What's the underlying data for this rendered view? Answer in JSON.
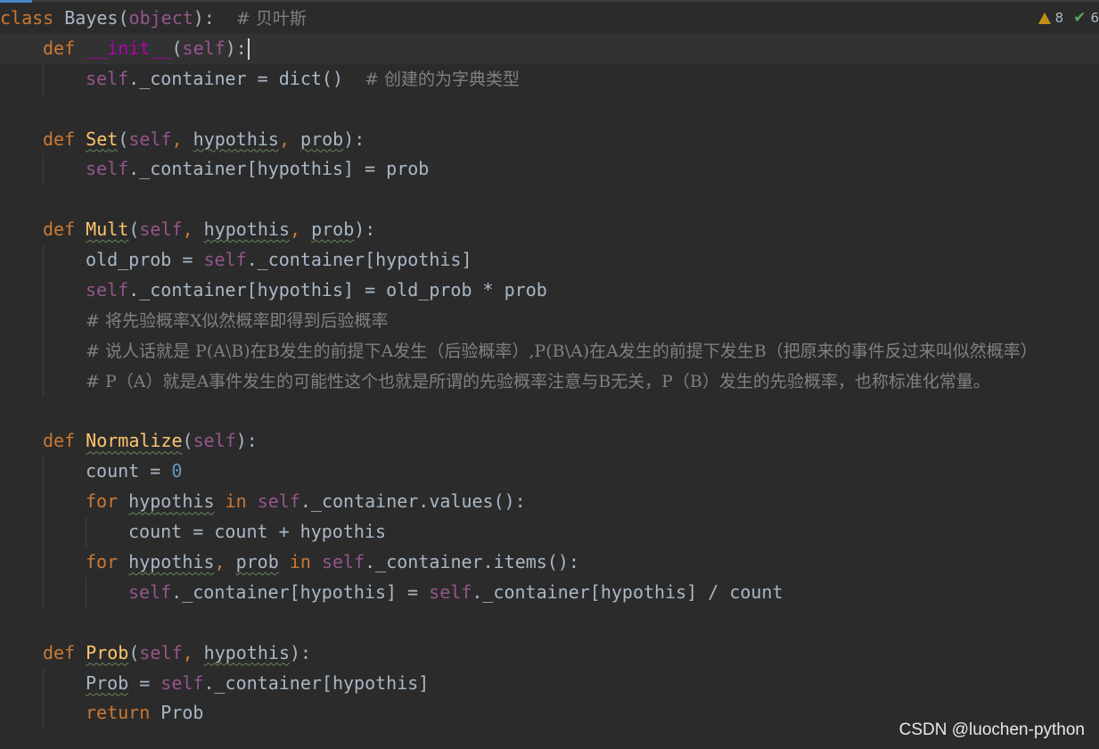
{
  "editor": {
    "inspection": {
      "warnings": "8",
      "weak_warnings": "6"
    },
    "code": {
      "l1": {
        "kw": "class",
        "name": "Bayes",
        "open": "(",
        "base": "object",
        "close": "):",
        "comment": "# 贝叶斯"
      },
      "l2": {
        "kw": "def",
        "name": "__init__",
        "open": "(",
        "self": "self",
        "close": "):"
      },
      "l3": {
        "self": "self",
        "attr": "._container = ",
        "call": "dict()",
        "comment": "# 创建的为字典类型"
      },
      "l5": {
        "kw": "def",
        "name": "Set",
        "open": "(",
        "self": "self",
        "comma1": ", ",
        "p1": "hypothis",
        "comma2": ", ",
        "p2": "prob",
        "close": "):"
      },
      "l6": {
        "self": "self",
        "rest": "._container[hypothis] = prob"
      },
      "l8": {
        "kw": "def",
        "name": "Mult",
        "open": "(",
        "self": "self",
        "comma1": ", ",
        "p1": "hypothis",
        "comma2": ", ",
        "p2": "prob",
        "close": "):"
      },
      "l9": {
        "lhs": "old_prob = ",
        "self": "self",
        "rest": "._container[hypothis]"
      },
      "l10": {
        "self": "self",
        "rest": "._container[hypothis] = old_prob * prob"
      },
      "l11": {
        "comment": "# 将先验概率X似然概率即得到后验概率"
      },
      "l12": {
        "comment": "# 说人话就是 P(A\\B)在B发生的前提下A发生（后验概率）,P(B\\A)在A发生的前提下发生B（把原来的事件反过来叫似然概率）"
      },
      "l13": {
        "comment": "# P（A）就是A事件发生的可能性这个也就是所谓的先验概率注意与B无关，P（B）发生的先验概率，也称标准化常量。"
      },
      "l15": {
        "kw": "def",
        "name": "Normalize",
        "open": "(",
        "self": "self",
        "close": "):"
      },
      "l16": {
        "lhs": "count = ",
        "num": "0"
      },
      "l17": {
        "kw": "for",
        "var": "hypothis",
        "kw2": "in",
        "self": "self",
        "rest": "._container.values():"
      },
      "l18": {
        "text": "count = count + hypothis"
      },
      "l19": {
        "kw": "for",
        "var1": "hypothis",
        "comma": ", ",
        "var2": "prob",
        "kw2": "in",
        "self": "self",
        "rest": "._container.items():"
      },
      "l20": {
        "self1": "self",
        "mid": "._container[hypothis] = ",
        "self2": "self",
        "rest": "._container[hypothis] / count"
      },
      "l22": {
        "kw": "def",
        "name": "Prob",
        "open": "(",
        "self": "self",
        "comma1": ", ",
        "p1": "hypothis",
        "close": "):"
      },
      "l23": {
        "var": "Prob",
        "eq": " = ",
        "self": "self",
        "rest": "._container[hypothis]"
      },
      "l24": {
        "kw": "return",
        "var": "Prob"
      }
    }
  },
  "watermark": "CSDN @luochen-python"
}
